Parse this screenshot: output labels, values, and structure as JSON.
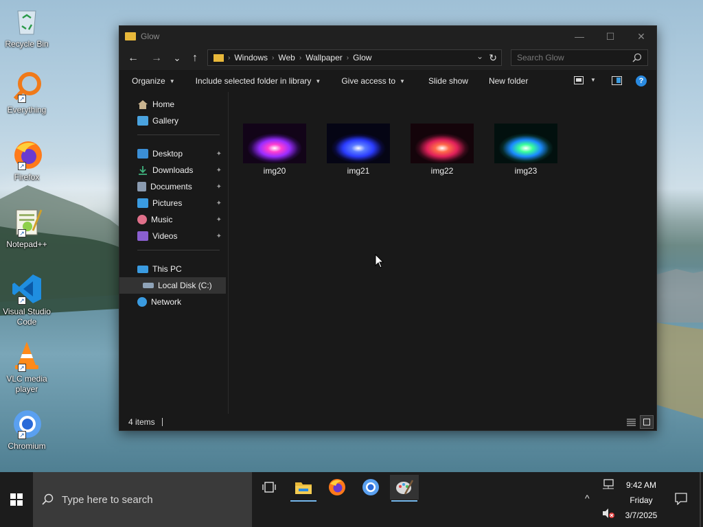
{
  "desktop": {
    "icons": [
      {
        "label": "Recycle Bin",
        "icon": "recycle-bin-icon"
      },
      {
        "label": "Everything",
        "icon": "everything-search-icon"
      },
      {
        "label": "Firefox",
        "icon": "firefox-icon"
      },
      {
        "label": "Notepad++",
        "icon": "notepad-plus-plus-icon"
      },
      {
        "label": "Visual Studio Code",
        "icon": "vscode-icon"
      },
      {
        "label": "VLC media player",
        "icon": "vlc-icon"
      },
      {
        "label": "Chromium",
        "icon": "chromium-icon"
      }
    ]
  },
  "window": {
    "title": "Glow",
    "minimize_glyph": "—",
    "maximize_glyph": "☐",
    "close_glyph": "✕"
  },
  "navbar": {
    "back_glyph": "←",
    "forward_glyph": "→",
    "recent_glyph": "⌄",
    "up_glyph": "↑",
    "breadcrumbs": [
      "Windows",
      "Web",
      "Wallpaper",
      "Glow"
    ],
    "crumb_separator": "›",
    "dropdown_glyph": "⌄",
    "refresh_glyph": "↻",
    "search_placeholder": "Search Glow"
  },
  "commands": [
    {
      "label": "Organize",
      "has_dropdown": true
    },
    {
      "label": "Include selected folder in library",
      "has_dropdown": true
    },
    {
      "label": "Give access to",
      "has_dropdown": true
    },
    {
      "label": "Slide show",
      "has_dropdown": false
    },
    {
      "label": "New folder",
      "has_dropdown": false
    }
  ],
  "caret_glyph": "▼",
  "help_glyph": "?",
  "nav_pane": {
    "quick": [
      {
        "label": "Home",
        "color": "#c9b38f"
      },
      {
        "label": "Gallery",
        "color": "#4aa3df"
      }
    ],
    "pinned": [
      {
        "label": "Desktop",
        "color": "#3b8fd6"
      },
      {
        "label": "Downloads",
        "color": "#3fb37f"
      },
      {
        "label": "Documents",
        "color": "#8a9bb0"
      },
      {
        "label": "Pictures",
        "color": "#3a9be0"
      },
      {
        "label": "Music",
        "color": "#e0708a"
      },
      {
        "label": "Videos",
        "color": "#8a5fd0"
      }
    ],
    "pin_glyph": "📌",
    "computer": [
      {
        "label": "This PC",
        "color": "#3a9be0"
      },
      {
        "label": "Local Disk (C:)",
        "color": "#8fa3b8"
      },
      {
        "label": "Network",
        "color": "#3a9be0"
      }
    ],
    "selected_color": "#333333"
  },
  "files": [
    {
      "name": "img20",
      "colors": [
        "#ff3fd0",
        "#9a2cff",
        "#2a0a4a"
      ]
    },
    {
      "name": "img21",
      "colors": [
        "#5a7bff",
        "#2a3cff",
        "#0a0a3a"
      ]
    },
    {
      "name": "img22",
      "colors": [
        "#ff6a4a",
        "#e0205a",
        "#3a0a1a"
      ]
    },
    {
      "name": "img23",
      "colors": [
        "#3aff9a",
        "#1a8aff",
        "#062a2a"
      ]
    }
  ],
  "status": {
    "item_count": "4 items"
  },
  "taskbar": {
    "search_placeholder": "Type here to search",
    "time": "9:42 AM",
    "day": "Friday",
    "date": "3/7/2025",
    "active_underline_color": "#76b9ed"
  }
}
